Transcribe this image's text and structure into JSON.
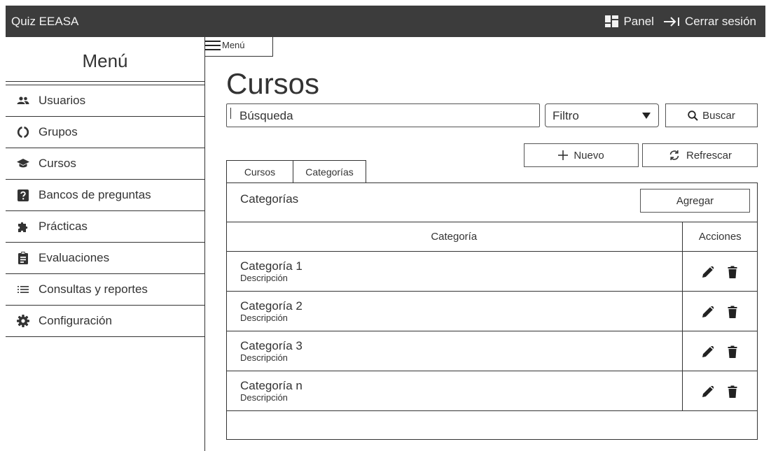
{
  "header": {
    "app_title": "Quiz EEASA",
    "panel_label": "Panel",
    "logout_label": "Cerrar sesión"
  },
  "sidebar": {
    "title": "Menú",
    "items": [
      {
        "label": "Usuarios",
        "icon": "users-icon"
      },
      {
        "label": "Grupos",
        "icon": "groups-icon"
      },
      {
        "label": "Cursos",
        "icon": "graduation-cap-icon"
      },
      {
        "label": "Bancos de preguntas",
        "icon": "question-box-icon"
      },
      {
        "label": "Prácticas",
        "icon": "puzzle-icon"
      },
      {
        "label": "Evaluaciones",
        "icon": "clipboard-icon"
      },
      {
        "label": "Consultas y reportes",
        "icon": "list-icon"
      },
      {
        "label": "Configuración",
        "icon": "gear-icon"
      }
    ]
  },
  "menu_toggle": {
    "label": "Menú"
  },
  "main": {
    "title": "Cursos",
    "search": {
      "value": "Búsqueda"
    },
    "filter": {
      "selected": "Filtro"
    },
    "search_button": "Buscar",
    "new_button": "Nuevo",
    "refresh_button": "Refrescar",
    "tabs": [
      {
        "label": "Cursos"
      },
      {
        "label": "Categorías",
        "active": true
      }
    ],
    "panel": {
      "title": "Categorías",
      "add_button": "Agregar",
      "columns": [
        "Categoría",
        "Acciones"
      ],
      "rows": [
        {
          "name": "Categoría 1",
          "description": "Descripción"
        },
        {
          "name": "Categoría 2",
          "description": "Descripción"
        },
        {
          "name": "Categoría 3",
          "description": "Descripción"
        },
        {
          "name": "Categoría n",
          "description": "Descripción"
        }
      ]
    }
  },
  "colors": {
    "topbar": "#3c3c3c",
    "text": "#333333",
    "border": "#333333"
  }
}
